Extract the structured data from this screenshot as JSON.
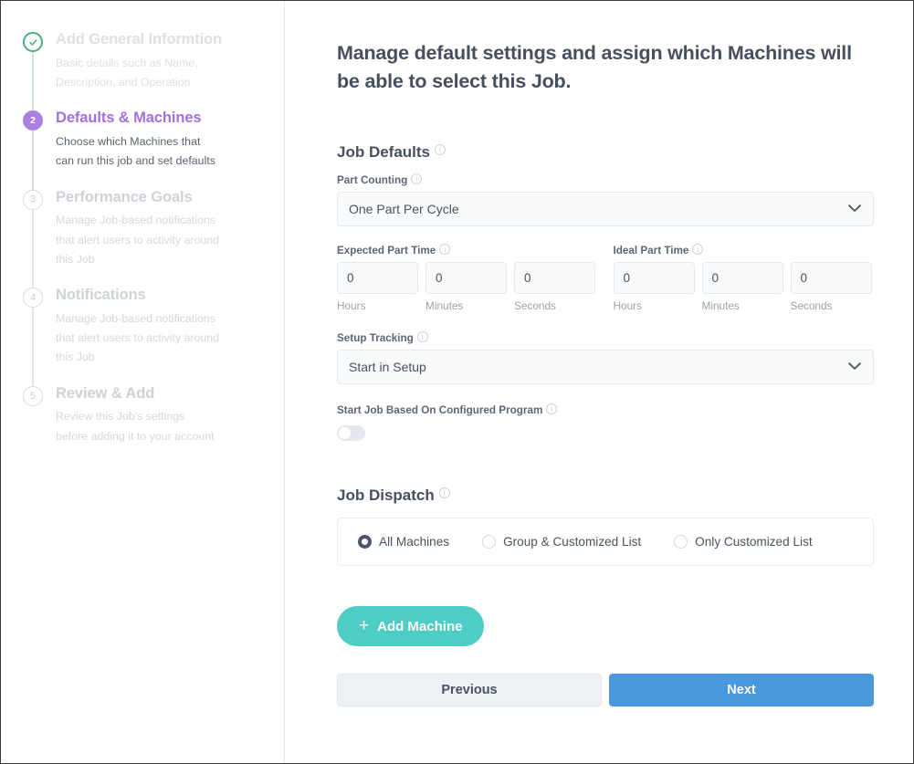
{
  "sidebar": {
    "steps": [
      {
        "number": "1",
        "marker": "check-icon",
        "state": "done",
        "title": "Add General Informtion",
        "description": "Basic details such as Name, Description, and Operation"
      },
      {
        "number": "2",
        "marker": "2",
        "state": "active",
        "title": "Defaults & Machines",
        "description": "Choose which Machines that can run this job and set defaults"
      },
      {
        "number": "3",
        "marker": "3",
        "state": "todo",
        "title": "Performance Goals",
        "description": "Manage Job-based notifications that alert users to activity around this Job"
      },
      {
        "number": "4",
        "marker": "4",
        "state": "todo",
        "title": "Notifications",
        "description": "Manage Job-based notifications that alert users to activity around this Job"
      },
      {
        "number": "5",
        "marker": "5",
        "state": "todo",
        "title": "Review & Add",
        "description": "Review this Job's settings before adding it to your account"
      }
    ]
  },
  "main": {
    "heading": "Manage default settings and assign which Machines will be able to select this Job.",
    "job_defaults": {
      "section_label": "Job Defaults",
      "part_counting": {
        "label": "Part Counting",
        "value": "One Part Per Cycle"
      },
      "expected_part_time": {
        "label": "Expected Part Time",
        "hours": {
          "value": "0",
          "unit": "Hours"
        },
        "minutes": {
          "value": "0",
          "unit": "Minutes"
        },
        "seconds": {
          "value": "0",
          "unit": "Seconds"
        }
      },
      "ideal_part_time": {
        "label": "Ideal Part Time",
        "hours": {
          "value": "0",
          "unit": "Hours"
        },
        "minutes": {
          "value": "0",
          "unit": "Minutes"
        },
        "seconds": {
          "value": "0",
          "unit": "Seconds"
        }
      },
      "setup_tracking": {
        "label": "Setup Tracking",
        "value": "Start in Setup"
      },
      "start_job_program": {
        "label": "Start Job Based On Configured Program",
        "toggle_state": "off"
      }
    },
    "job_dispatch": {
      "section_label": "Job Dispatch",
      "options": [
        {
          "label": "All Machines",
          "selected": true
        },
        {
          "label": "Group & Customized List",
          "selected": false
        },
        {
          "label": "Only Customized List",
          "selected": false
        }
      ]
    },
    "add_machine_label": "Add Machine",
    "footer": {
      "previous_label": "Previous",
      "next_label": "Next"
    }
  },
  "icons": {
    "info": "i",
    "plus": "+",
    "chevron_down": "chevron-down-icon",
    "check": "check-icon"
  },
  "colors": {
    "accent_purple": "#a26fdd",
    "accent_green": "#4caf7d",
    "teal_button": "#4ecdc4",
    "blue_button": "#4a97de",
    "text_dark": "#464f5e",
    "muted": "#cdd2d8"
  }
}
